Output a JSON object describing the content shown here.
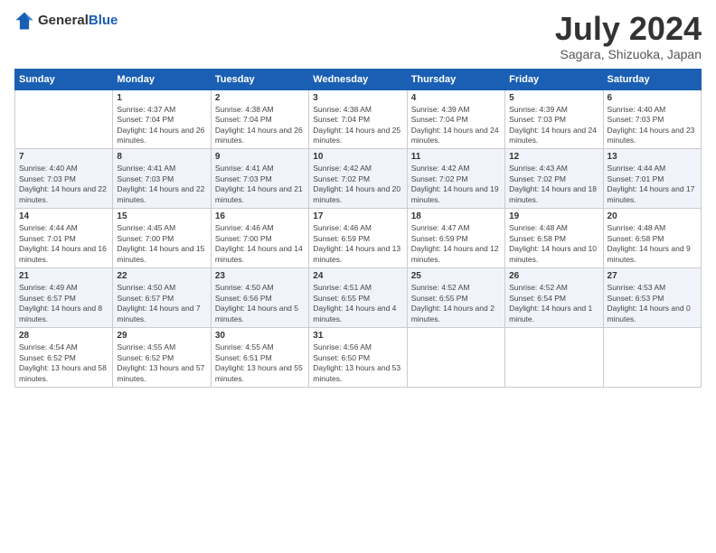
{
  "header": {
    "logo_general": "General",
    "logo_blue": "Blue",
    "month_title": "July 2024",
    "location": "Sagara, Shizuoka, Japan"
  },
  "weekdays": [
    "Sunday",
    "Monday",
    "Tuesday",
    "Wednesday",
    "Thursday",
    "Friday",
    "Saturday"
  ],
  "weeks": [
    [
      {
        "day": "",
        "sunrise": "",
        "sunset": "",
        "daylight": ""
      },
      {
        "day": "1",
        "sunrise": "Sunrise: 4:37 AM",
        "sunset": "Sunset: 7:04 PM",
        "daylight": "Daylight: 14 hours and 26 minutes."
      },
      {
        "day": "2",
        "sunrise": "Sunrise: 4:38 AM",
        "sunset": "Sunset: 7:04 PM",
        "daylight": "Daylight: 14 hours and 26 minutes."
      },
      {
        "day": "3",
        "sunrise": "Sunrise: 4:38 AM",
        "sunset": "Sunset: 7:04 PM",
        "daylight": "Daylight: 14 hours and 25 minutes."
      },
      {
        "day": "4",
        "sunrise": "Sunrise: 4:39 AM",
        "sunset": "Sunset: 7:04 PM",
        "daylight": "Daylight: 14 hours and 24 minutes."
      },
      {
        "day": "5",
        "sunrise": "Sunrise: 4:39 AM",
        "sunset": "Sunset: 7:03 PM",
        "daylight": "Daylight: 14 hours and 24 minutes."
      },
      {
        "day": "6",
        "sunrise": "Sunrise: 4:40 AM",
        "sunset": "Sunset: 7:03 PM",
        "daylight": "Daylight: 14 hours and 23 minutes."
      }
    ],
    [
      {
        "day": "7",
        "sunrise": "Sunrise: 4:40 AM",
        "sunset": "Sunset: 7:03 PM",
        "daylight": "Daylight: 14 hours and 22 minutes."
      },
      {
        "day": "8",
        "sunrise": "Sunrise: 4:41 AM",
        "sunset": "Sunset: 7:03 PM",
        "daylight": "Daylight: 14 hours and 22 minutes."
      },
      {
        "day": "9",
        "sunrise": "Sunrise: 4:41 AM",
        "sunset": "Sunset: 7:03 PM",
        "daylight": "Daylight: 14 hours and 21 minutes."
      },
      {
        "day": "10",
        "sunrise": "Sunrise: 4:42 AM",
        "sunset": "Sunset: 7:02 PM",
        "daylight": "Daylight: 14 hours and 20 minutes."
      },
      {
        "day": "11",
        "sunrise": "Sunrise: 4:42 AM",
        "sunset": "Sunset: 7:02 PM",
        "daylight": "Daylight: 14 hours and 19 minutes."
      },
      {
        "day": "12",
        "sunrise": "Sunrise: 4:43 AM",
        "sunset": "Sunset: 7:02 PM",
        "daylight": "Daylight: 14 hours and 18 minutes."
      },
      {
        "day": "13",
        "sunrise": "Sunrise: 4:44 AM",
        "sunset": "Sunset: 7:01 PM",
        "daylight": "Daylight: 14 hours and 17 minutes."
      }
    ],
    [
      {
        "day": "14",
        "sunrise": "Sunrise: 4:44 AM",
        "sunset": "Sunset: 7:01 PM",
        "daylight": "Daylight: 14 hours and 16 minutes."
      },
      {
        "day": "15",
        "sunrise": "Sunrise: 4:45 AM",
        "sunset": "Sunset: 7:00 PM",
        "daylight": "Daylight: 14 hours and 15 minutes."
      },
      {
        "day": "16",
        "sunrise": "Sunrise: 4:46 AM",
        "sunset": "Sunset: 7:00 PM",
        "daylight": "Daylight: 14 hours and 14 minutes."
      },
      {
        "day": "17",
        "sunrise": "Sunrise: 4:46 AM",
        "sunset": "Sunset: 6:59 PM",
        "daylight": "Daylight: 14 hours and 13 minutes."
      },
      {
        "day": "18",
        "sunrise": "Sunrise: 4:47 AM",
        "sunset": "Sunset: 6:59 PM",
        "daylight": "Daylight: 14 hours and 12 minutes."
      },
      {
        "day": "19",
        "sunrise": "Sunrise: 4:48 AM",
        "sunset": "Sunset: 6:58 PM",
        "daylight": "Daylight: 14 hours and 10 minutes."
      },
      {
        "day": "20",
        "sunrise": "Sunrise: 4:48 AM",
        "sunset": "Sunset: 6:58 PM",
        "daylight": "Daylight: 14 hours and 9 minutes."
      }
    ],
    [
      {
        "day": "21",
        "sunrise": "Sunrise: 4:49 AM",
        "sunset": "Sunset: 6:57 PM",
        "daylight": "Daylight: 14 hours and 8 minutes."
      },
      {
        "day": "22",
        "sunrise": "Sunrise: 4:50 AM",
        "sunset": "Sunset: 6:57 PM",
        "daylight": "Daylight: 14 hours and 7 minutes."
      },
      {
        "day": "23",
        "sunrise": "Sunrise: 4:50 AM",
        "sunset": "Sunset: 6:56 PM",
        "daylight": "Daylight: 14 hours and 5 minutes."
      },
      {
        "day": "24",
        "sunrise": "Sunrise: 4:51 AM",
        "sunset": "Sunset: 6:55 PM",
        "daylight": "Daylight: 14 hours and 4 minutes."
      },
      {
        "day": "25",
        "sunrise": "Sunrise: 4:52 AM",
        "sunset": "Sunset: 6:55 PM",
        "daylight": "Daylight: 14 hours and 2 minutes."
      },
      {
        "day": "26",
        "sunrise": "Sunrise: 4:52 AM",
        "sunset": "Sunset: 6:54 PM",
        "daylight": "Daylight: 14 hours and 1 minute."
      },
      {
        "day": "27",
        "sunrise": "Sunrise: 4:53 AM",
        "sunset": "Sunset: 6:53 PM",
        "daylight": "Daylight: 14 hours and 0 minutes."
      }
    ],
    [
      {
        "day": "28",
        "sunrise": "Sunrise: 4:54 AM",
        "sunset": "Sunset: 6:52 PM",
        "daylight": "Daylight: 13 hours and 58 minutes."
      },
      {
        "day": "29",
        "sunrise": "Sunrise: 4:55 AM",
        "sunset": "Sunset: 6:52 PM",
        "daylight": "Daylight: 13 hours and 57 minutes."
      },
      {
        "day": "30",
        "sunrise": "Sunrise: 4:55 AM",
        "sunset": "Sunset: 6:51 PM",
        "daylight": "Daylight: 13 hours and 55 minutes."
      },
      {
        "day": "31",
        "sunrise": "Sunrise: 4:56 AM",
        "sunset": "Sunset: 6:50 PM",
        "daylight": "Daylight: 13 hours and 53 minutes."
      },
      {
        "day": "",
        "sunrise": "",
        "sunset": "",
        "daylight": ""
      },
      {
        "day": "",
        "sunrise": "",
        "sunset": "",
        "daylight": ""
      },
      {
        "day": "",
        "sunrise": "",
        "sunset": "",
        "daylight": ""
      }
    ]
  ]
}
